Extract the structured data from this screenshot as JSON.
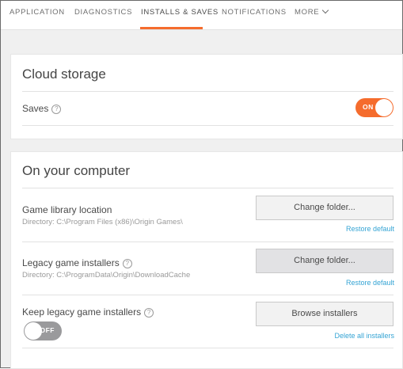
{
  "tabs": [
    {
      "label": "APPLICATION"
    },
    {
      "label": "DIAGNOSTICS"
    },
    {
      "label": "INSTALLS & SAVES",
      "active": true
    },
    {
      "label": "NOTIFICATIONS"
    },
    {
      "label": "MORE"
    }
  ],
  "accent_color": "#f56c2d",
  "link_color": "#35a4d4",
  "cloud": {
    "title": "Cloud storage",
    "saves_label": "Saves",
    "saves_help": "?",
    "saves_toggle_label": "ON",
    "saves_enabled": true
  },
  "computer": {
    "title": "On your computer",
    "library": {
      "label": "Game library location",
      "directory": "Directory: C:\\Program Files (x86)\\Origin Games\\",
      "button": "Change folder...",
      "restore": "Restore default"
    },
    "legacy": {
      "label": "Legacy game installers",
      "help": "?",
      "directory": "Directory: C:\\ProgramData\\Origin\\DownloadCache",
      "button": "Change folder...",
      "restore": "Restore default"
    },
    "keep": {
      "label": "Keep legacy game installers",
      "help": "?",
      "toggle_label": "OFF",
      "enabled": false,
      "button": "Browse installers",
      "delete": "Delete all installers"
    }
  }
}
